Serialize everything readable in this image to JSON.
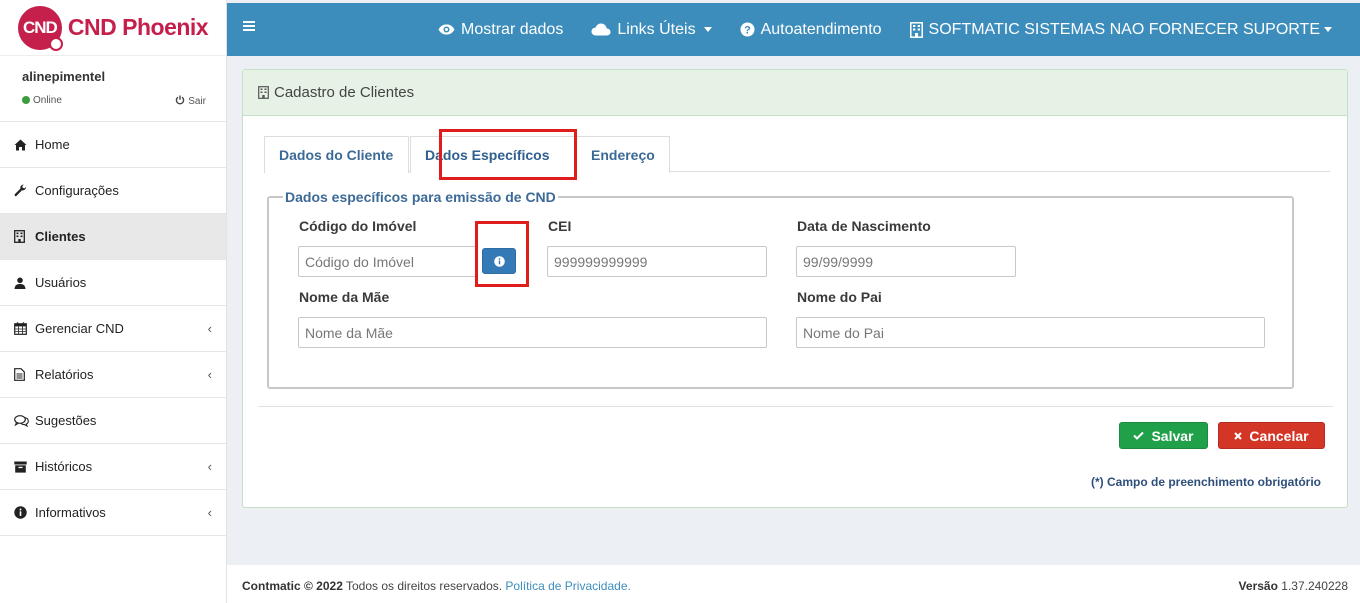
{
  "brand": {
    "badge": "CND",
    "name": "CND Phoenix",
    "color": "#c51f4b"
  },
  "user": {
    "name": "alinepimentel",
    "status": "Online",
    "logout": "Sair"
  },
  "sidebar": {
    "items": [
      {
        "label": "Home",
        "icon": "home-icon",
        "expandable": false
      },
      {
        "label": "Configurações",
        "icon": "wrench-icon",
        "expandable": false
      },
      {
        "label": "Clientes",
        "icon": "building-icon",
        "expandable": false,
        "active": true
      },
      {
        "label": "Usuários",
        "icon": "user-icon",
        "expandable": false
      },
      {
        "label": "Gerenciar CND",
        "icon": "calendar-icon",
        "expandable": true
      },
      {
        "label": "Relatórios",
        "icon": "document-icon",
        "expandable": true
      },
      {
        "label": "Sugestões",
        "icon": "comments-icon",
        "expandable": false
      },
      {
        "label": "Históricos",
        "icon": "archive-icon",
        "expandable": true
      },
      {
        "label": "Informativos",
        "icon": "info-icon",
        "expandable": true
      }
    ]
  },
  "navbar": {
    "show_data": "Mostrar dados",
    "links": "Links Úteis",
    "support": "Autoatendimento",
    "company": "SOFTMATIC SISTEMAS NAO FORNECER SUPORTE",
    "color": "#3c8dbc"
  },
  "panel": {
    "title": "Cadastro de Clientes",
    "tabs": [
      {
        "label": "Dados do Cliente"
      },
      {
        "label": "Dados Específicos",
        "active": true
      },
      {
        "label": "Endereço"
      }
    ],
    "fieldset_legend": "Dados específicos para emissão de CND",
    "fields": {
      "property_code": {
        "label": "Código do Imóvel",
        "placeholder": "Código do Imóvel",
        "value": ""
      },
      "cei": {
        "label": "CEI",
        "placeholder": "999999999999",
        "value": ""
      },
      "birth_date": {
        "label": "Data de Nascimento",
        "placeholder": "99/99/9999",
        "value": ""
      },
      "mother_name": {
        "label": "Nome da Mãe",
        "placeholder": "Nome da Mãe",
        "value": ""
      },
      "father_name": {
        "label": "Nome do Pai",
        "placeholder": "Nome do Pai",
        "value": ""
      }
    },
    "save": "Salvar",
    "cancel": "Cancelar",
    "required_note": "(*) Campo de preenchimento obrigatório",
    "highlight_color": "#e01d1d"
  },
  "footer": {
    "company": "Contmatic © 2022",
    "rights": "Todos os direitos reservados.",
    "privacy": "Política de Privacidade.",
    "version_label": "Versão",
    "version": "1.37.240228"
  }
}
